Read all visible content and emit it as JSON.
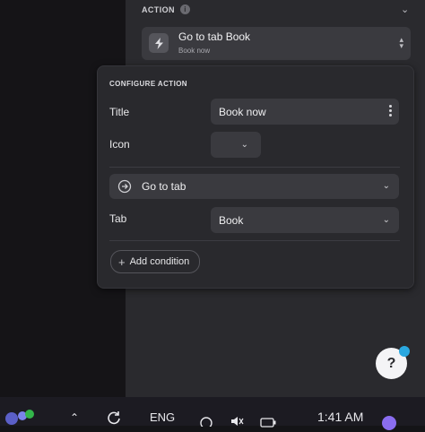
{
  "action_section": {
    "header": "ACTION",
    "selected_title": "Go to tab Book",
    "selected_subtitle": "Book now"
  },
  "configure": {
    "title": "CONFIGURE ACTION",
    "title_label": "Title",
    "title_value": "Book now",
    "icon_label": "Icon",
    "action_type": "Go to tab",
    "tab_label": "Tab",
    "tab_value": "Book",
    "add_condition": "Add condition"
  },
  "help": {
    "label": "?"
  },
  "taskbar": {
    "language": "ENG",
    "time": "1:41 AM"
  },
  "colors": {
    "panel_bg": "#2a2a2e",
    "popover_bg": "#29292d",
    "field_bg": "#3a3a3f",
    "accent_badge": "#2aa8e0"
  }
}
